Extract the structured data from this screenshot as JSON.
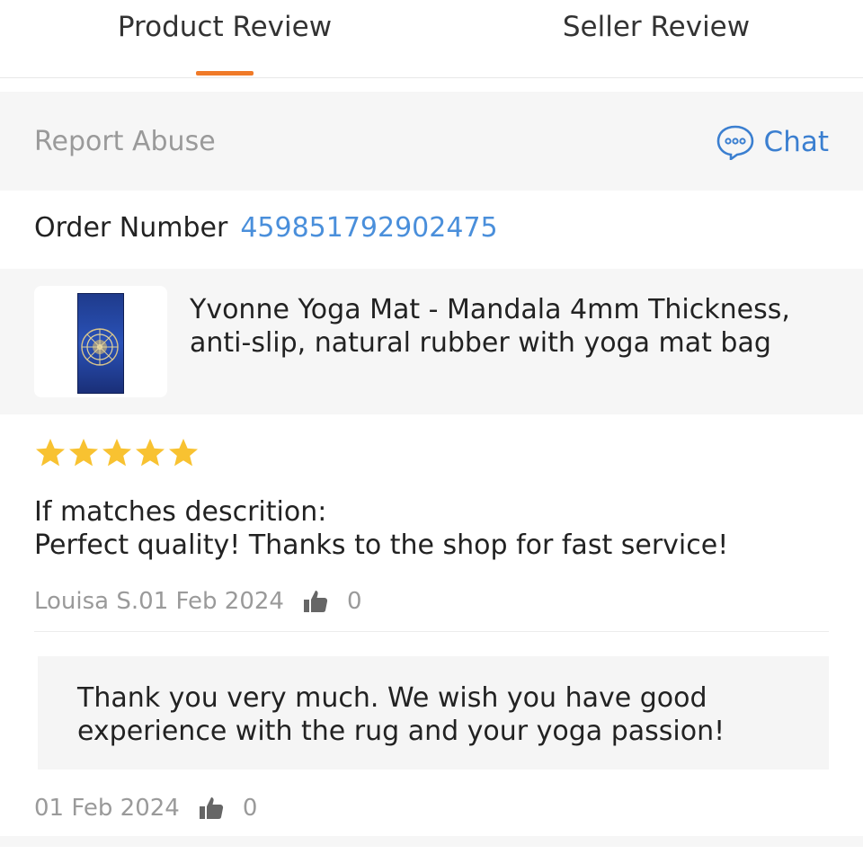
{
  "tabs": [
    {
      "label": "Product Review",
      "active": true
    },
    {
      "label": "Seller Review",
      "active": false
    }
  ],
  "colors": {
    "accent": "#f07a28",
    "link": "#4a8fdb",
    "chat": "#3b7fd0",
    "star": "#f8c231",
    "muted": "#9a9a9a"
  },
  "header": {
    "report_abuse": "Report Abuse",
    "chat_label": "Chat",
    "chat_icon": "chat-bubble-icon"
  },
  "order": {
    "label": "Order Number",
    "number": "459851792902475"
  },
  "product": {
    "title": "Yvonne Yoga Mat - Mandala 4mm Thickness, anti-slip, natural rubber with yoga mat bag",
    "thumbnail": "yoga-mat-thumbnail"
  },
  "review": {
    "rating": 5,
    "rating_max": 5,
    "label": "If matches descrition:",
    "text": "Perfect quality! Thanks to the shop for fast service!",
    "author_date": "Louisa S.01 Feb 2024",
    "likes": "0"
  },
  "reply": {
    "text": "Thank you very much. We wish you have good experience with the rug and your yoga passion!",
    "date": "01 Feb 2024",
    "likes": "0"
  }
}
